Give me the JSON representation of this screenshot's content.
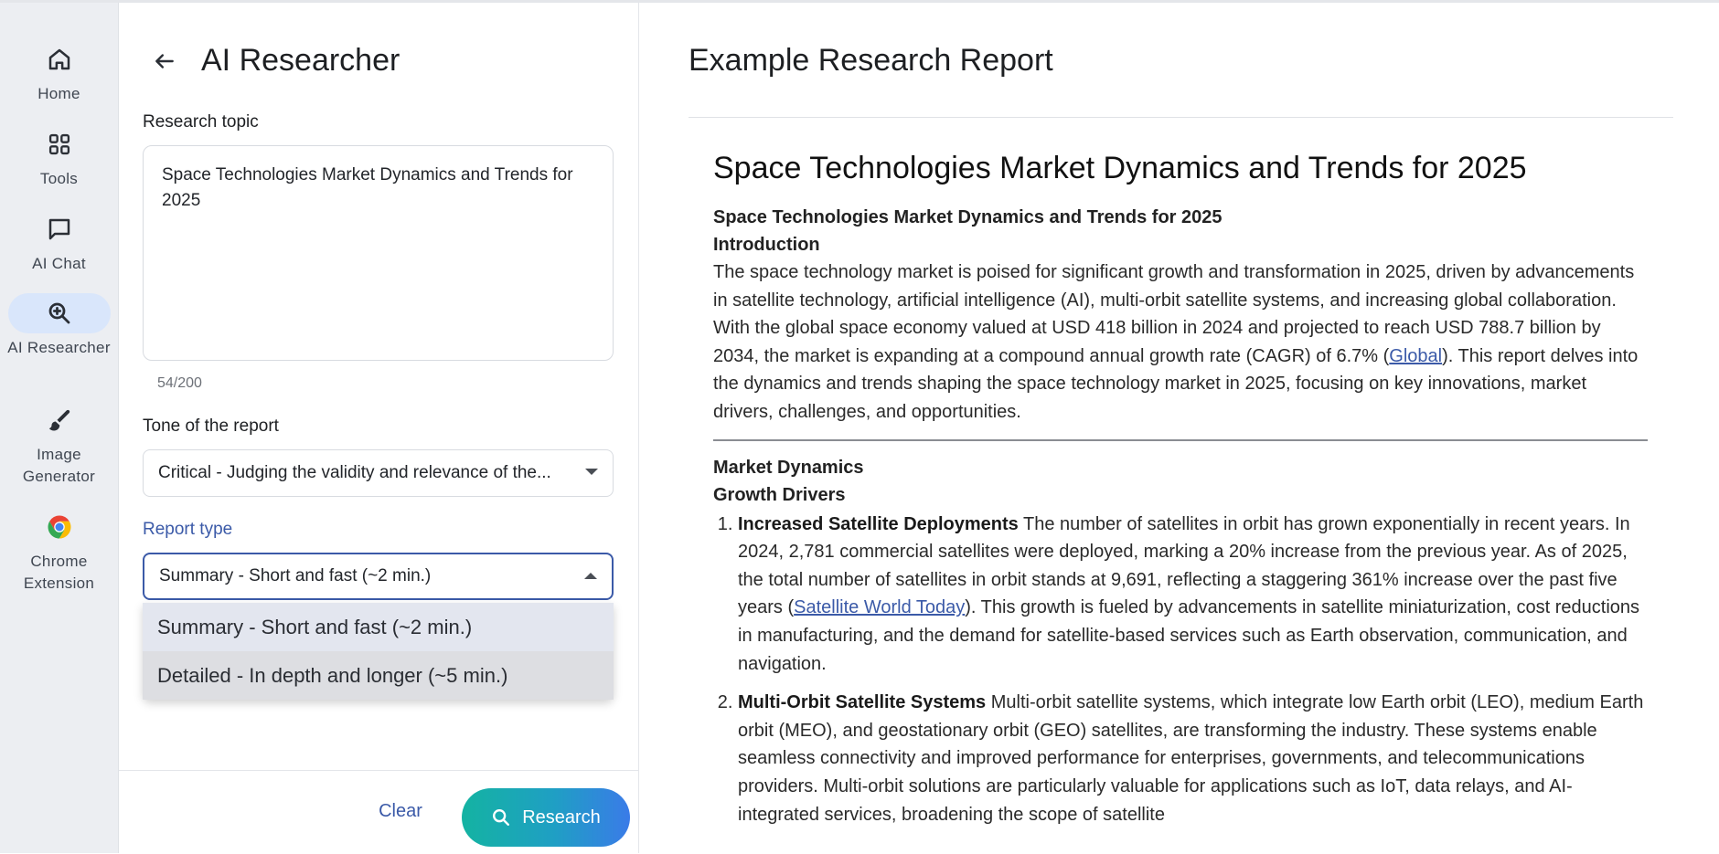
{
  "rail": {
    "items": [
      {
        "label": "Home",
        "icon": "home-icon"
      },
      {
        "label": "Tools",
        "icon": "grid-icon"
      },
      {
        "label": "AI Chat",
        "icon": "chat-icon"
      },
      {
        "label": "AI Researcher",
        "icon": "search-zoom-icon",
        "active": true
      },
      {
        "label": "Image Generator",
        "icon": "brush-icon"
      },
      {
        "label": "Chrome Extension",
        "icon": "chrome-icon"
      }
    ]
  },
  "panel": {
    "title": "AI Researcher",
    "topic_label": "Research topic",
    "topic_value": "Space Technologies Market Dynamics and Trends for 2025",
    "counter": "54/200",
    "tone_label": "Tone of the report",
    "tone_value": "Critical - Judging the validity and relevance of the...",
    "report_type_label": "Report type",
    "report_type_value": "Summary - Short and fast (~2 min.)",
    "report_type_options": [
      "Summary - Short and fast (~2 min.)",
      "Detailed - In depth and longer (~5 min.)"
    ],
    "clear_label": "Clear",
    "research_label": "Research"
  },
  "report": {
    "heading": "Example Research Report",
    "title": "Space Technologies Market Dynamics and Trends for 2025",
    "subtitle": "Space Technologies Market Dynamics and Trends for 2025",
    "intro_heading": "Introduction",
    "intro_text_1": "The space technology market is poised for significant growth and transformation in 2025, driven by advancements in satellite technology, artificial intelligence (AI), multi-orbit satellite systems, and increasing global collaboration. With the global space economy valued at USD 418 billion in 2024 and projected to reach USD 788.7 billion by 2034, the market is expanding at a compound annual growth rate (CAGR) of 6.7% (",
    "intro_link": "Global",
    "intro_text_2": "). This report delves into the dynamics and trends shaping the space technology market in 2025, focusing on key innovations, market drivers, challenges, and opportunities.",
    "section_heading": "Market Dynamics",
    "subsection_heading": "Growth Drivers",
    "item1_title": "Increased Satellite Deployments",
    "item1_text_1": " The number of satellites in orbit has grown exponentially in recent years. In 2024, 2,781 commercial satellites were deployed, marking a 20% increase from the previous year. As of 2025, the total number of satellites in orbit stands at 9,691, reflecting a staggering 361% increase over the past five years (",
    "item1_link": "Satellite World Today",
    "item1_text_2": "). This growth is fueled by advancements in satellite miniaturization, cost reductions in manufacturing, and the demand for satellite-based services such as Earth observation, communication, and navigation.",
    "item2_title": "Multi-Orbit Satellite Systems",
    "item2_text": " Multi-orbit satellite systems, which integrate low Earth orbit (LEO), medium Earth orbit (MEO), and geostationary orbit (GEO) satellites, are transforming the industry. These systems enable seamless connectivity and improved performance for enterprises, governments, and telecommunications providers. Multi-orbit solutions are particularly valuable for applications such as IoT, data relays, and AI-integrated services, broadening the scope of satellite"
  },
  "colors": {
    "accent": "#3b5aa8",
    "rail_bg": "#eceef2",
    "active_pill": "#d9e6fb",
    "research_gradient_start": "#14b3a2",
    "research_gradient_end": "#3a7be8"
  }
}
